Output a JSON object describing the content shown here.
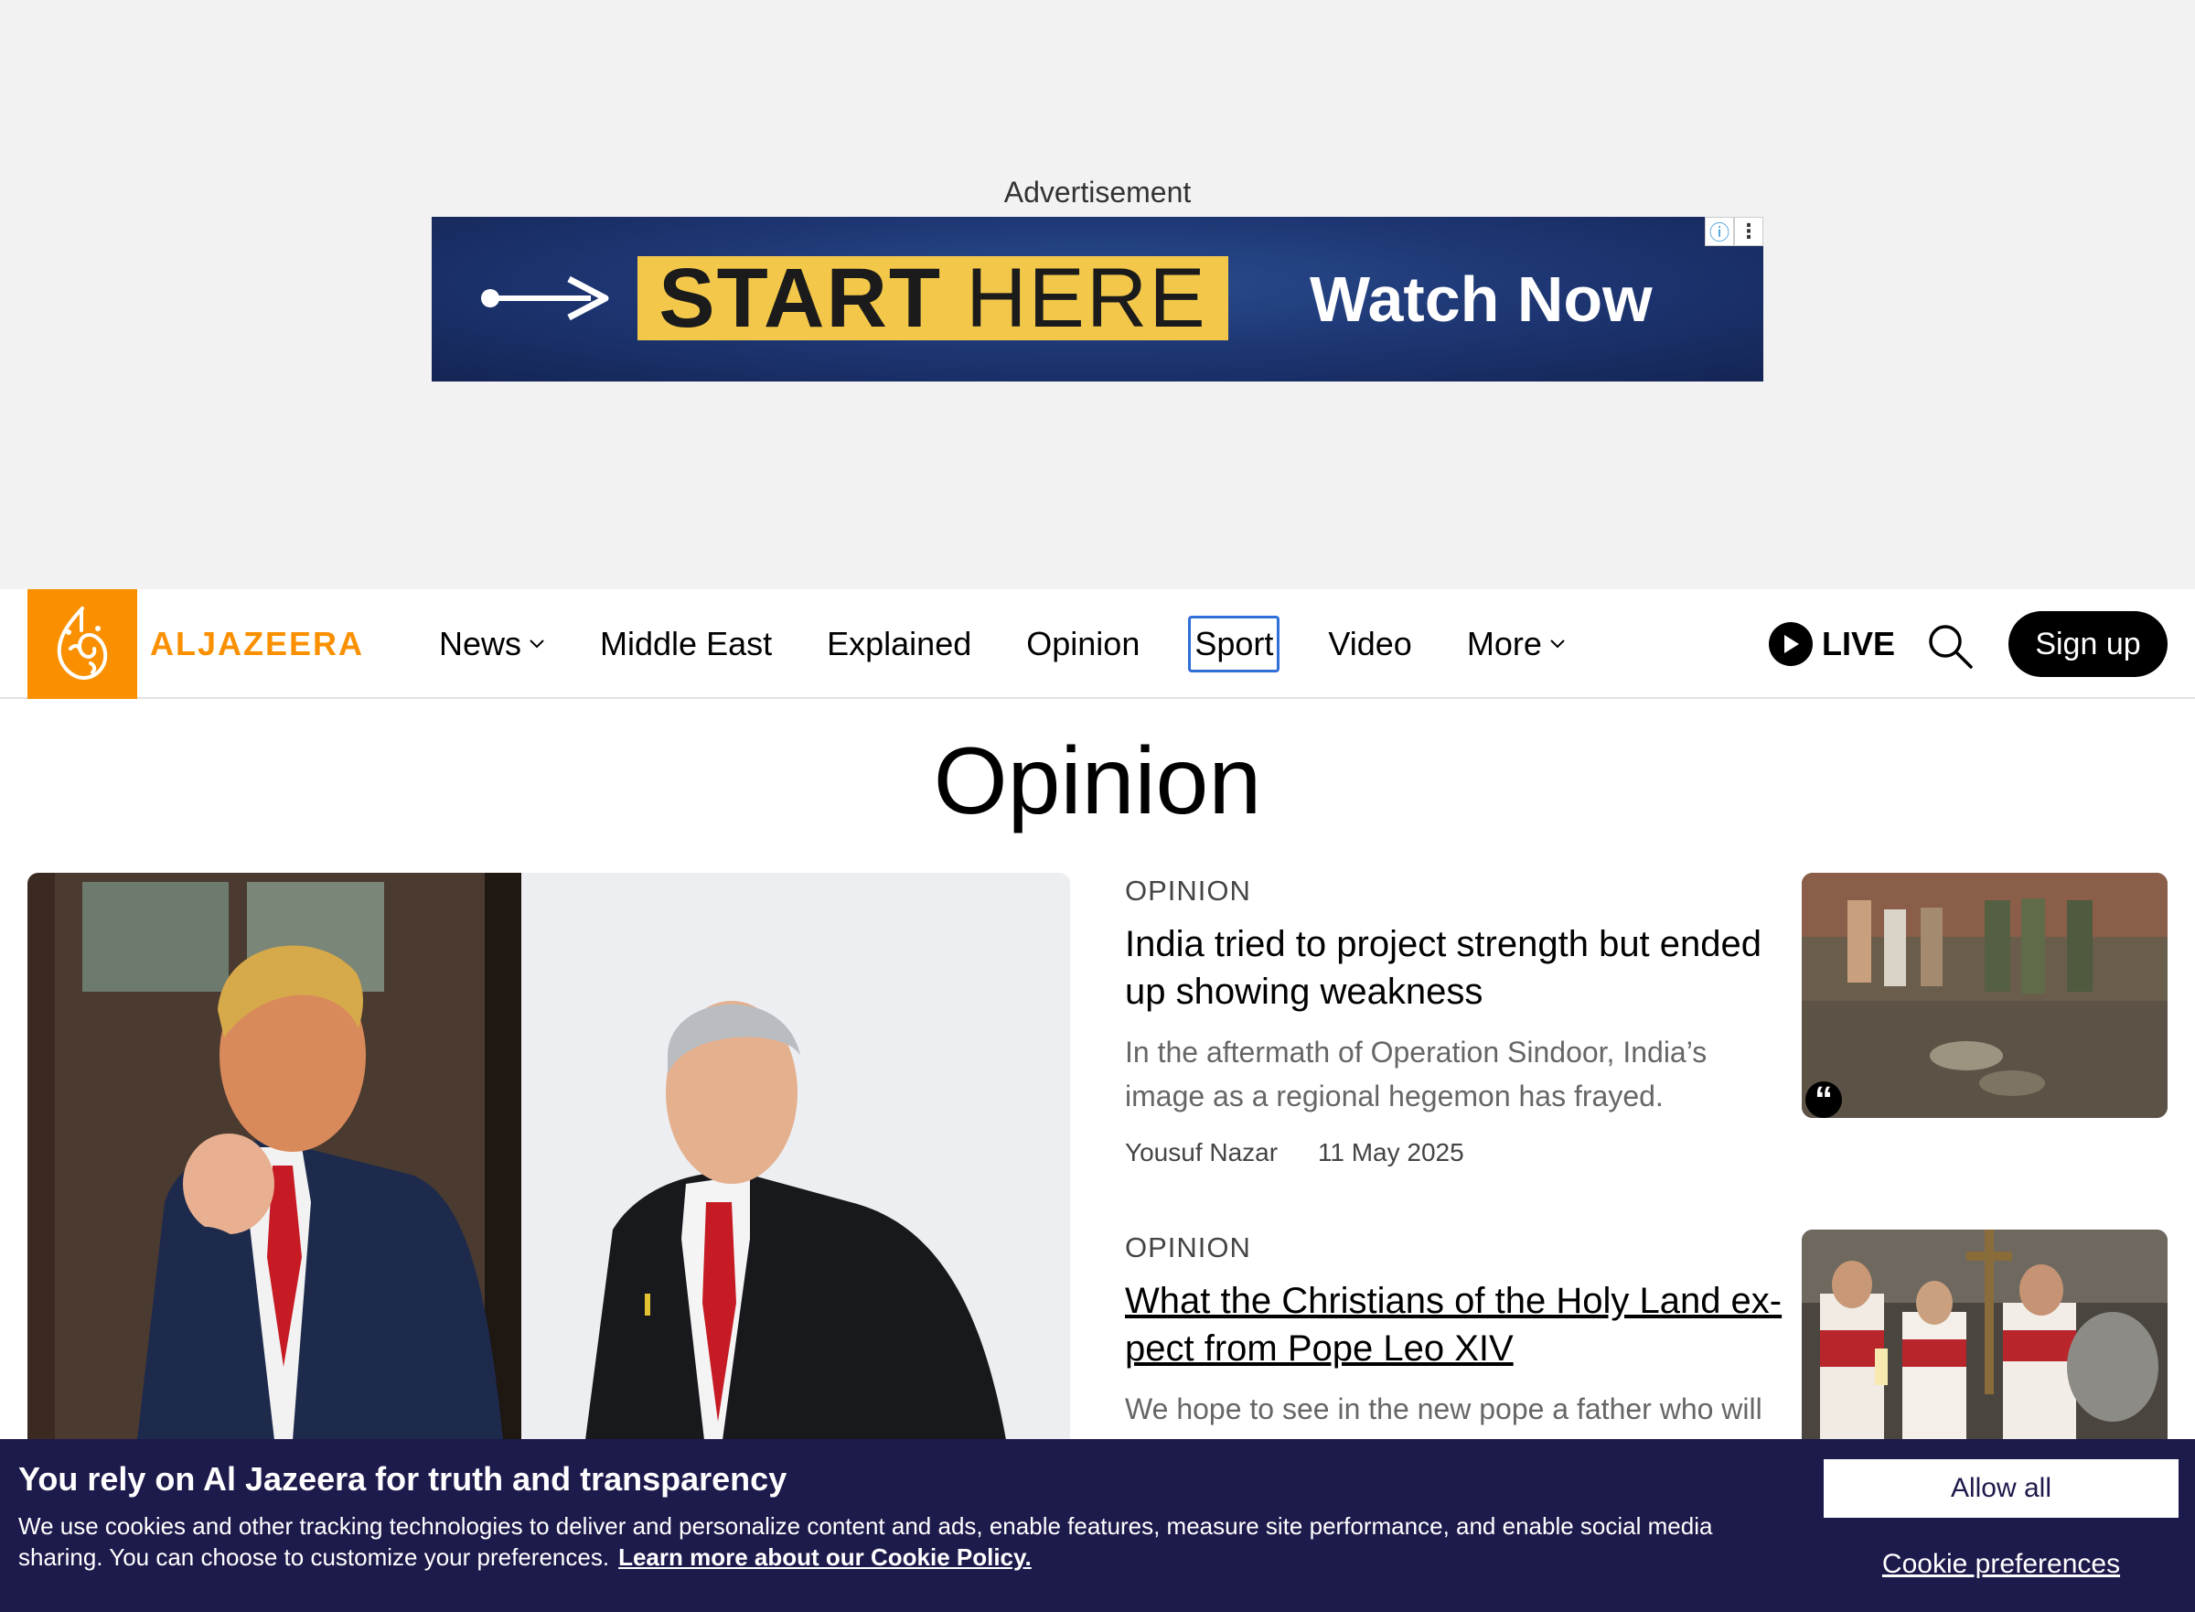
{
  "ad": {
    "label": "Advertisement",
    "start_bold": "START",
    "start_light": "HERE",
    "watch": "Watch Now",
    "info_icon": "info-icon",
    "menu_icon": "kebab-menu-icon"
  },
  "header": {
    "logo_text": "ALJAZEERA",
    "nav": [
      {
        "label": "News",
        "dropdown": true
      },
      {
        "label": "Middle East",
        "dropdown": false
      },
      {
        "label": "Explained",
        "dropdown": false
      },
      {
        "label": "Opinion",
        "dropdown": false
      },
      {
        "label": "Sport",
        "dropdown": false,
        "focused": true
      },
      {
        "label": "Video",
        "dropdown": false
      },
      {
        "label": "More",
        "dropdown": true
      }
    ],
    "live_label": "LIVE",
    "signup_label": "Sign up"
  },
  "page": {
    "title": "Opinion"
  },
  "articles": [
    {
      "kicker": "OPINION",
      "headline": "India tried to project strength but ended up showing weakness",
      "summary": "In the aftermath of Operation Sindoor, India’s image as a regional hegemon has frayed.",
      "author": "Yousuf Nazar",
      "date": "11 May 2025"
    },
    {
      "kicker": "OPINION",
      "headline": "What the Christians of the Holy Land ex-pect from Pope Leo XIV",
      "summary": "We hope to see in the new pope a father who will"
    }
  ],
  "cookie": {
    "title": "You rely on Al Jazeera for truth and transparency",
    "text": "We use cookies and other tracking technologies to deliver and personalize content and ads, enable features, measure site performance, and enable social media sharing. You can choose to customize your preferences.",
    "link": "Learn more about our Cookie Policy.",
    "allow_label": "Allow all",
    "pref_label": "Cookie preferences"
  },
  "colors": {
    "brand_orange": "#fa9000",
    "cookie_bg": "#1d1a4c",
    "focus_outline": "#2f6fd8"
  }
}
